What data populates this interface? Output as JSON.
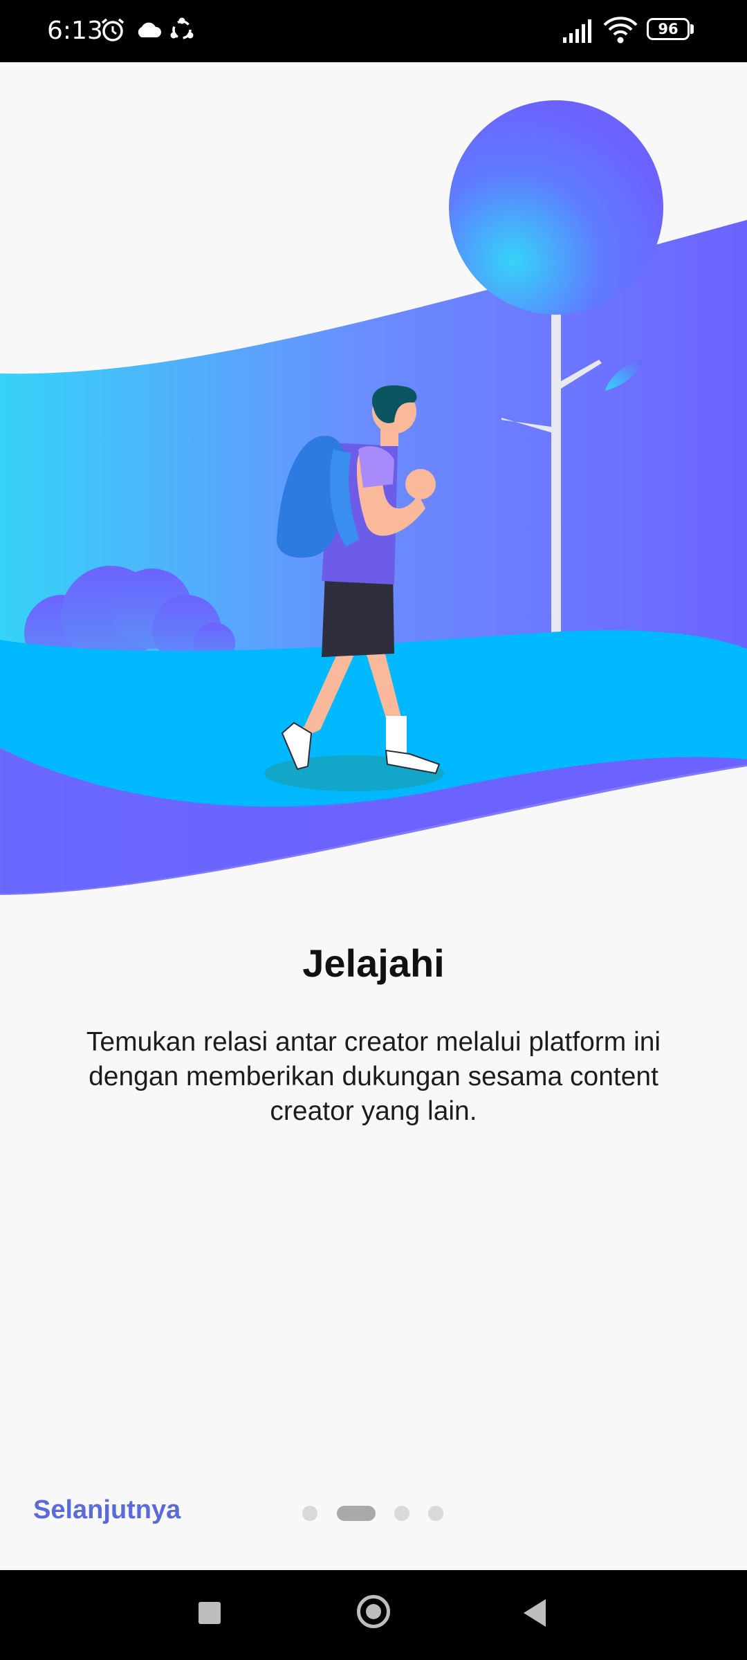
{
  "status_bar": {
    "time": "6:13",
    "battery": "96",
    "icons": [
      "alarm-icon",
      "cloud-icon",
      "sync-icon",
      "signal-icon",
      "wifi-icon",
      "battery-icon"
    ]
  },
  "onboarding": {
    "title": "Jelajahi",
    "description": "Temukan relasi antar creator melalui platform ini dengan memberikan dukungan sesama content creator yang lain.",
    "next_label": "Selanjutnya",
    "page_indicator": {
      "total": 4,
      "active": 2
    }
  },
  "colors": {
    "accent": "#5a6ad6",
    "purple": "#6c63ff",
    "cyan": "#00b8ff",
    "light_cyan": "#36d3f8"
  }
}
